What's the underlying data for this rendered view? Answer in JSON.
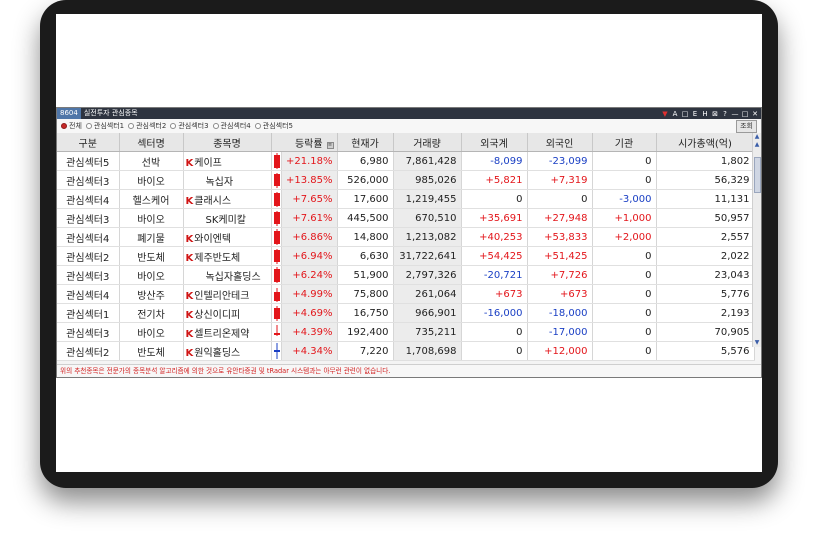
{
  "window": {
    "code": "8604",
    "title": "실전투자 관심종목",
    "controls": [
      "▼",
      "A",
      "□",
      "E",
      "H",
      "⊠",
      "?",
      "—",
      "□",
      "✕"
    ]
  },
  "tabs": [
    {
      "label": "전체",
      "selected": true
    },
    {
      "label": "관심섹터1",
      "selected": false
    },
    {
      "label": "관심섹터2",
      "selected": false
    },
    {
      "label": "관심섹터3",
      "selected": false
    },
    {
      "label": "관심섹터4",
      "selected": false
    },
    {
      "label": "관심섹터5",
      "selected": false
    }
  ],
  "lookup_label": "조회",
  "columns": [
    "구분",
    "섹터명",
    "종목명",
    "",
    "등락률",
    "현재가",
    "거래량",
    "외국계",
    "외국인",
    "기관",
    "시가총액(억)"
  ],
  "rows": [
    {
      "group": "관심섹터5",
      "sector": "선박",
      "stock": "케이프",
      "k": true,
      "candle": {
        "color": "red",
        "body": [
          0.1,
          0.95
        ],
        "wick": [
          0.0,
          1.0
        ]
      },
      "change": "+21.18%",
      "price": "6,980",
      "volume": "7,861,428",
      "foreignFirm": "-8,099",
      "foreigner": "-23,099",
      "inst": "0",
      "cap": "1,802"
    },
    {
      "group": "관심섹터3",
      "sector": "바이오",
      "stock": "녹십자",
      "k": false,
      "candle": {
        "color": "red",
        "body": [
          0.15,
          0.9
        ],
        "wick": [
          0.05,
          1.0
        ]
      },
      "change": "+13.85%",
      "price": "526,000",
      "volume": "985,026",
      "foreignFirm": "+5,821",
      "foreigner": "+7,319",
      "inst": "0",
      "cap": "56,329"
    },
    {
      "group": "관심섹터4",
      "sector": "헬스케어",
      "stock": "클래시스",
      "k": true,
      "candle": {
        "color": "red",
        "body": [
          0.15,
          0.95
        ],
        "wick": [
          0.05,
          1.0
        ]
      },
      "change": "+7.65%",
      "price": "17,600",
      "volume": "1,219,455",
      "foreignFirm": "0",
      "foreigner": "0",
      "inst": "-3,000",
      "cap": "11,131"
    },
    {
      "group": "관심섹터3",
      "sector": "바이오",
      "stock": "SK케미칼",
      "k": false,
      "candle": {
        "color": "red",
        "body": [
          0.15,
          0.9
        ],
        "wick": [
          0.05,
          1.0
        ]
      },
      "change": "+7.61%",
      "price": "445,500",
      "volume": "670,510",
      "foreignFirm": "+35,691",
      "foreigner": "+27,948",
      "inst": "+1,000",
      "cap": "50,957"
    },
    {
      "group": "관심섹터4",
      "sector": "폐기물",
      "stock": "와이엔텍",
      "k": true,
      "candle": {
        "color": "red",
        "body": [
          0.1,
          0.95
        ],
        "wick": [
          0.0,
          1.0
        ]
      },
      "change": "+6.86%",
      "price": "14,800",
      "volume": "1,213,082",
      "foreignFirm": "+40,253",
      "foreigner": "+53,833",
      "inst": "+2,000",
      "cap": "2,557"
    },
    {
      "group": "관심섹터2",
      "sector": "반도체",
      "stock": "제주반도체",
      "k": true,
      "candle": {
        "color": "red",
        "body": [
          0.15,
          0.9
        ],
        "wick": [
          0.05,
          1.0
        ]
      },
      "change": "+6.94%",
      "price": "6,630",
      "volume": "31,722,641",
      "foreignFirm": "+54,425",
      "foreigner": "+51,425",
      "inst": "0",
      "cap": "2,022"
    },
    {
      "group": "관심섹터3",
      "sector": "바이오",
      "stock": "녹십자홀딩스",
      "k": false,
      "candle": {
        "color": "red",
        "body": [
          0.1,
          0.95
        ],
        "wick": [
          0.0,
          1.0
        ]
      },
      "change": "+6.24%",
      "price": "51,900",
      "volume": "2,797,326",
      "foreignFirm": "-20,721",
      "foreigner": "+7,726",
      "inst": "0",
      "cap": "23,043"
    },
    {
      "group": "관심섹터4",
      "sector": "방산주",
      "stock": "인텔리안테크",
      "k": true,
      "candle": {
        "color": "red",
        "body": [
          0.35,
          0.95
        ],
        "wick": [
          0.1,
          1.0
        ]
      },
      "change": "+4.99%",
      "price": "75,800",
      "volume": "261,064",
      "foreignFirm": "+673",
      "foreigner": "+673",
      "inst": "0",
      "cap": "5,776"
    },
    {
      "group": "관심섹터1",
      "sector": "전기차",
      "stock": "상신이디피",
      "k": true,
      "candle": {
        "color": "red",
        "body": [
          0.2,
          0.85
        ],
        "wick": [
          0.05,
          1.0
        ]
      },
      "change": "+4.69%",
      "price": "16,750",
      "volume": "966,901",
      "foreignFirm": "-16,000",
      "foreigner": "-18,000",
      "inst": "0",
      "cap": "2,193"
    },
    {
      "group": "관심섹터3",
      "sector": "바이오",
      "stock": "셀트리온제약",
      "k": true,
      "candle": {
        "color": "red",
        "body": [
          0.55,
          0.7
        ],
        "wick": [
          0.05,
          0.75
        ]
      },
      "change": "+4.39%",
      "price": "192,400",
      "volume": "735,211",
      "foreignFirm": "0",
      "foreigner": "-17,000",
      "inst": "0",
      "cap": "70,905"
    },
    {
      "group": "관심섹터2",
      "sector": "반도체",
      "stock": "원익홀딩스",
      "k": true,
      "candle": {
        "color": "blue",
        "body": [
          0.45,
          0.55
        ],
        "wick": [
          0.0,
          1.0
        ]
      },
      "change": "+4.34%",
      "price": "7,220",
      "volume": "1,708,698",
      "foreignFirm": "0",
      "foreigner": "+12,000",
      "inst": "0",
      "cap": "5,576"
    }
  ],
  "notice": "위의 추천종목은 전문가의 종목분석 알고리즘에 의한 것으로 유안타증권 및 tRadar 시스템과는 아무런 관련이 없습니다.",
  "colors": {
    "up": "#e3161b",
    "down": "#1a3fc4",
    "titlebar": "#2e3440"
  }
}
